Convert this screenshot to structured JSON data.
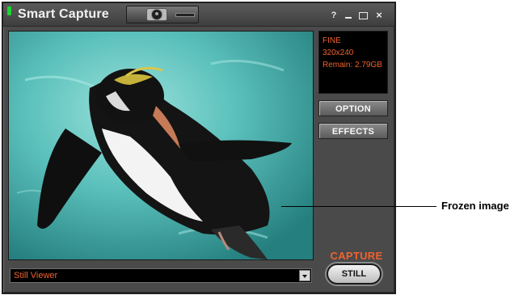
{
  "window": {
    "title": "Smart Capture",
    "controls": {
      "help": "?",
      "close": "×"
    }
  },
  "status_panel": {
    "quality": "FINE",
    "resolution": "320x240",
    "remain": "Remain: 2.79GB"
  },
  "buttons": {
    "option": "OPTION",
    "effects": "EFFECTS",
    "still": "STILL"
  },
  "capture_label": "CAPTURE",
  "viewer_select": {
    "value": "Still Viewer"
  },
  "callout": {
    "label": "Frozen image"
  },
  "colors": {
    "accent": "#f0622e",
    "led": "#19d72f",
    "window_bg": "#4a4a4a"
  },
  "icons": [
    "camera-icon",
    "help-icon",
    "minimize-icon",
    "maximize-icon",
    "close-icon",
    "dropdown-arrow-icon"
  ]
}
